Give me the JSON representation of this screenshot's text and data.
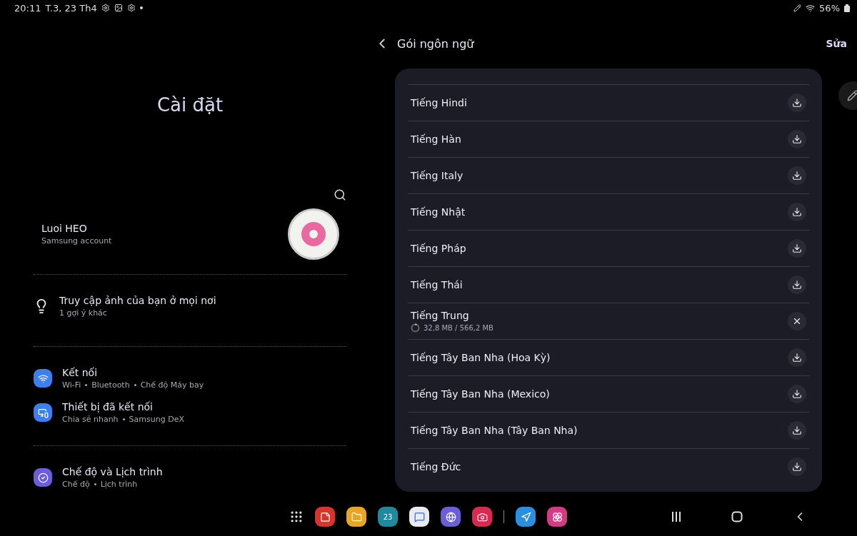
{
  "status_bar": {
    "time": "20:11",
    "date": "T.3, 23 Th4",
    "battery": "56%"
  },
  "settings": {
    "title": "Cài đặt",
    "profile": {
      "name": "Luoi HEO",
      "account": "Samsung account"
    },
    "suggestion": {
      "title": "Truy cập ảnh của bạn ở mọi nơi",
      "subtitle": "1 gợi ý khác"
    },
    "groups": [
      [
        {
          "kind": "wifi",
          "color": "#3d7ff0",
          "title": "Kết nối",
          "details": [
            "Wi-Fi",
            "Bluetooth",
            "Chế độ Máy bay"
          ]
        },
        {
          "kind": "devices",
          "color": "#3d7ff0",
          "title": "Thiết bị đã kết nối",
          "details": [
            "Chia sẻ nhanh",
            "Samsung DeX"
          ]
        }
      ],
      [
        {
          "kind": "modes",
          "color": "#6b5ce0",
          "title": "Chế độ và Lịch trình",
          "details": [
            "Chế độ",
            "Lịch trình"
          ]
        }
      ]
    ]
  },
  "language_packs": {
    "title": "Gói ngôn ngữ",
    "edit": "Sửa",
    "items": [
      {
        "kind": "download",
        "name": "Tiếng Hindi"
      },
      {
        "kind": "download",
        "name": "Tiếng Hàn"
      },
      {
        "kind": "download",
        "name": "Tiếng Italy"
      },
      {
        "kind": "download",
        "name": "Tiếng Nhật"
      },
      {
        "kind": "download",
        "name": "Tiếng Pháp"
      },
      {
        "kind": "download",
        "name": "Tiếng Thái"
      },
      {
        "kind": "downloading",
        "name": "Tiếng Trung",
        "progress": "32,8 MB / 566,2 MB",
        "level": 0.06
      },
      {
        "kind": "download",
        "name": "Tiếng Tây Ban Nha (Hoa Kỳ)"
      },
      {
        "kind": "download",
        "name": "Tiếng Tây Ban Nha (Mexico)"
      },
      {
        "kind": "download",
        "name": "Tiếng Tây Ban Nha (Tây Ban Nha)"
      },
      {
        "kind": "download",
        "name": "Tiếng Đức"
      }
    ]
  },
  "taskbar": {
    "apps": [
      {
        "kind": "notes",
        "color": "#d8342c"
      },
      {
        "kind": "files",
        "color": "#e9a524"
      },
      {
        "kind": "calendar",
        "color": "#1f8a9c",
        "label": "23"
      },
      {
        "kind": "messages",
        "color": "#e8eaf0"
      },
      {
        "kind": "internet",
        "color": "#6a5fd6"
      },
      {
        "kind": "camera",
        "color": "#d8294f"
      },
      {
        "kind": "divider"
      },
      {
        "kind": "arrow",
        "color": "#2a8fe0"
      },
      {
        "kind": "flower",
        "color": "#d43a86"
      }
    ]
  }
}
